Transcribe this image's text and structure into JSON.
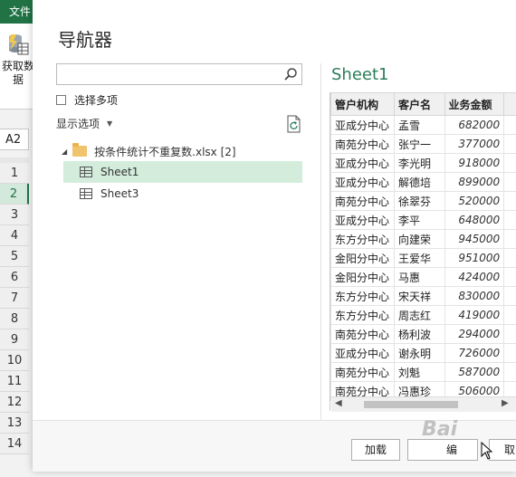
{
  "excel": {
    "file_tab": "文件",
    "get_data_label": "获取数",
    "get_data_label2": "据",
    "namebox": "A2",
    "row_numbers": [
      "1",
      "2",
      "3",
      "4",
      "5",
      "6",
      "7",
      "8",
      "9",
      "10",
      "11",
      "12",
      "13",
      "14"
    ],
    "selected_row": "2"
  },
  "dialog": {
    "title": "导航器",
    "search_placeholder": "",
    "multi_select_label": "选择多项",
    "display_options_label": "显示选项",
    "tree": {
      "file_label": "按条件统计不重复数.xlsx [2]",
      "sheets": [
        "Sheet1",
        "Sheet3"
      ],
      "selected": "Sheet1"
    },
    "preview": {
      "title": "Sheet1",
      "columns": [
        "管户机构",
        "客户名",
        "业务金额"
      ],
      "rows": [
        [
          "亚成分中心",
          "孟雪",
          "682000"
        ],
        [
          "南苑分中心",
          "张宁一",
          "377000"
        ],
        [
          "亚成分中心",
          "李光明",
          "918000"
        ],
        [
          "亚成分中心",
          "解德培",
          "899000"
        ],
        [
          "南苑分中心",
          "徐翠芬",
          "520000"
        ],
        [
          "亚成分中心",
          "李平",
          "648000"
        ],
        [
          "东方分中心",
          "向建荣",
          "945000"
        ],
        [
          "金阳分中心",
          "王爱华",
          "951000"
        ],
        [
          "金阳分中心",
          "马惠",
          "424000"
        ],
        [
          "东方分中心",
          "宋天祥",
          "830000"
        ],
        [
          "东方分中心",
          "周志红",
          "419000"
        ],
        [
          "南苑分中心",
          "杨利波",
          "294000"
        ],
        [
          "亚成分中心",
          "谢永明",
          "726000"
        ],
        [
          "南苑分中心",
          "刘魁",
          "587000"
        ],
        [
          "南苑分中心",
          "冯惠珍",
          "506000"
        ]
      ]
    },
    "buttons": {
      "load": "加载",
      "transform": "编",
      "cancel": "取"
    },
    "watermark": "Bai"
  },
  "colors": {
    "excel_green": "#217346",
    "selection_bg": "#d3ecdc",
    "preview_title": "#2b7d5a"
  }
}
